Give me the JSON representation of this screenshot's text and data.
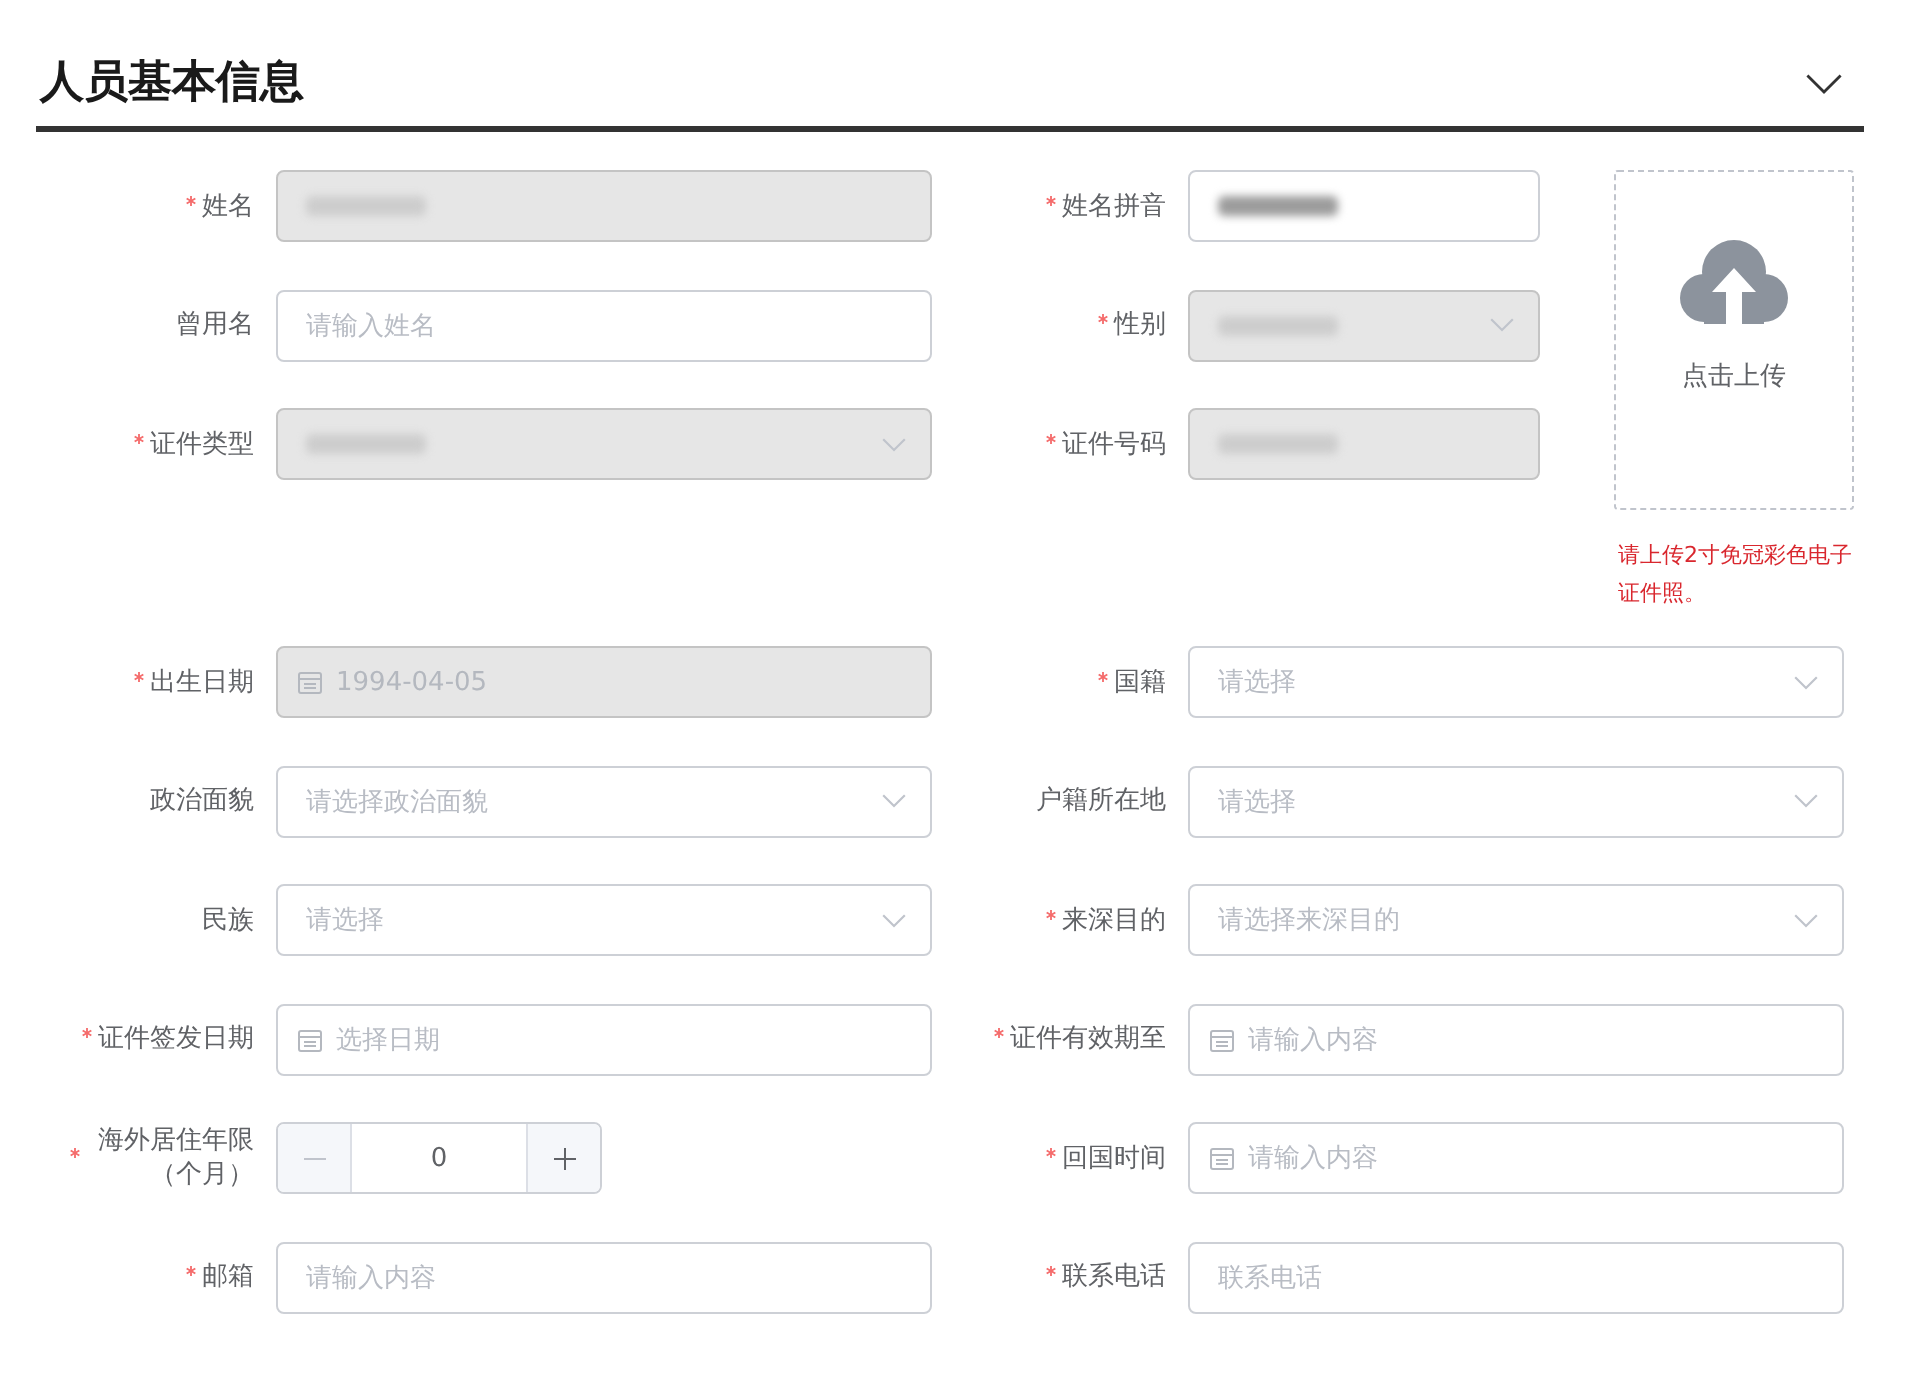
{
  "section": {
    "title": "人员基本信息"
  },
  "top_fields": [
    {
      "label": "姓名",
      "required": true,
      "kind": "text",
      "disabled": true,
      "redacted": true
    },
    {
      "label": "姓名拼音",
      "required": true,
      "kind": "text",
      "disabled": false,
      "redacted": true
    },
    {
      "label": "曾用名",
      "required": false,
      "kind": "text",
      "disabled": false,
      "redacted": false,
      "placeholder": "请输入姓名"
    },
    {
      "label": "性别",
      "required": true,
      "kind": "select",
      "disabled": true,
      "redacted": true
    },
    {
      "label": "证件类型",
      "required": true,
      "kind": "select",
      "disabled": true,
      "redacted": true
    },
    {
      "label": "证件号码",
      "required": true,
      "kind": "text",
      "disabled": true,
      "redacted": true
    }
  ],
  "photo_upload": {
    "label": "点击上传",
    "hint": "请上传2寸免冠彩色电子证件照。"
  },
  "fields": [
    {
      "label": "出生日期",
      "required": true,
      "kind": "date",
      "disabled": true,
      "value": "1994-04-05"
    },
    {
      "label": "国籍",
      "required": true,
      "kind": "select",
      "disabled": false,
      "placeholder": "请选择"
    },
    {
      "label": "政治面貌",
      "required": false,
      "kind": "select",
      "disabled": false,
      "placeholder": "请选择政治面貌"
    },
    {
      "label": "户籍所在地",
      "required": false,
      "kind": "select",
      "disabled": false,
      "placeholder": "请选择"
    },
    {
      "label": "民族",
      "required": false,
      "kind": "select",
      "disabled": false,
      "placeholder": "请选择"
    },
    {
      "label": "来深目的",
      "required": true,
      "kind": "select",
      "disabled": false,
      "placeholder": "请选择来深目的"
    },
    {
      "label": "证件签发日期",
      "required": true,
      "kind": "date",
      "disabled": false,
      "placeholder": "选择日期"
    },
    {
      "label": "证件有效期至",
      "required": true,
      "kind": "date",
      "disabled": false,
      "placeholder": "请输入内容"
    },
    {
      "label": "海外居住年限（个月）",
      "required": true,
      "kind": "number",
      "disabled": false,
      "value": "0",
      "decrement_disabled": true
    },
    {
      "label": "回国时间",
      "required": true,
      "kind": "date",
      "disabled": false,
      "placeholder": "请输入内容"
    },
    {
      "label": "邮箱",
      "required": true,
      "kind": "text",
      "disabled": false,
      "placeholder": "请输入内容"
    },
    {
      "label": "联系电话",
      "required": true,
      "kind": "text",
      "disabled": false,
      "placeholder": "联系电话"
    }
  ]
}
